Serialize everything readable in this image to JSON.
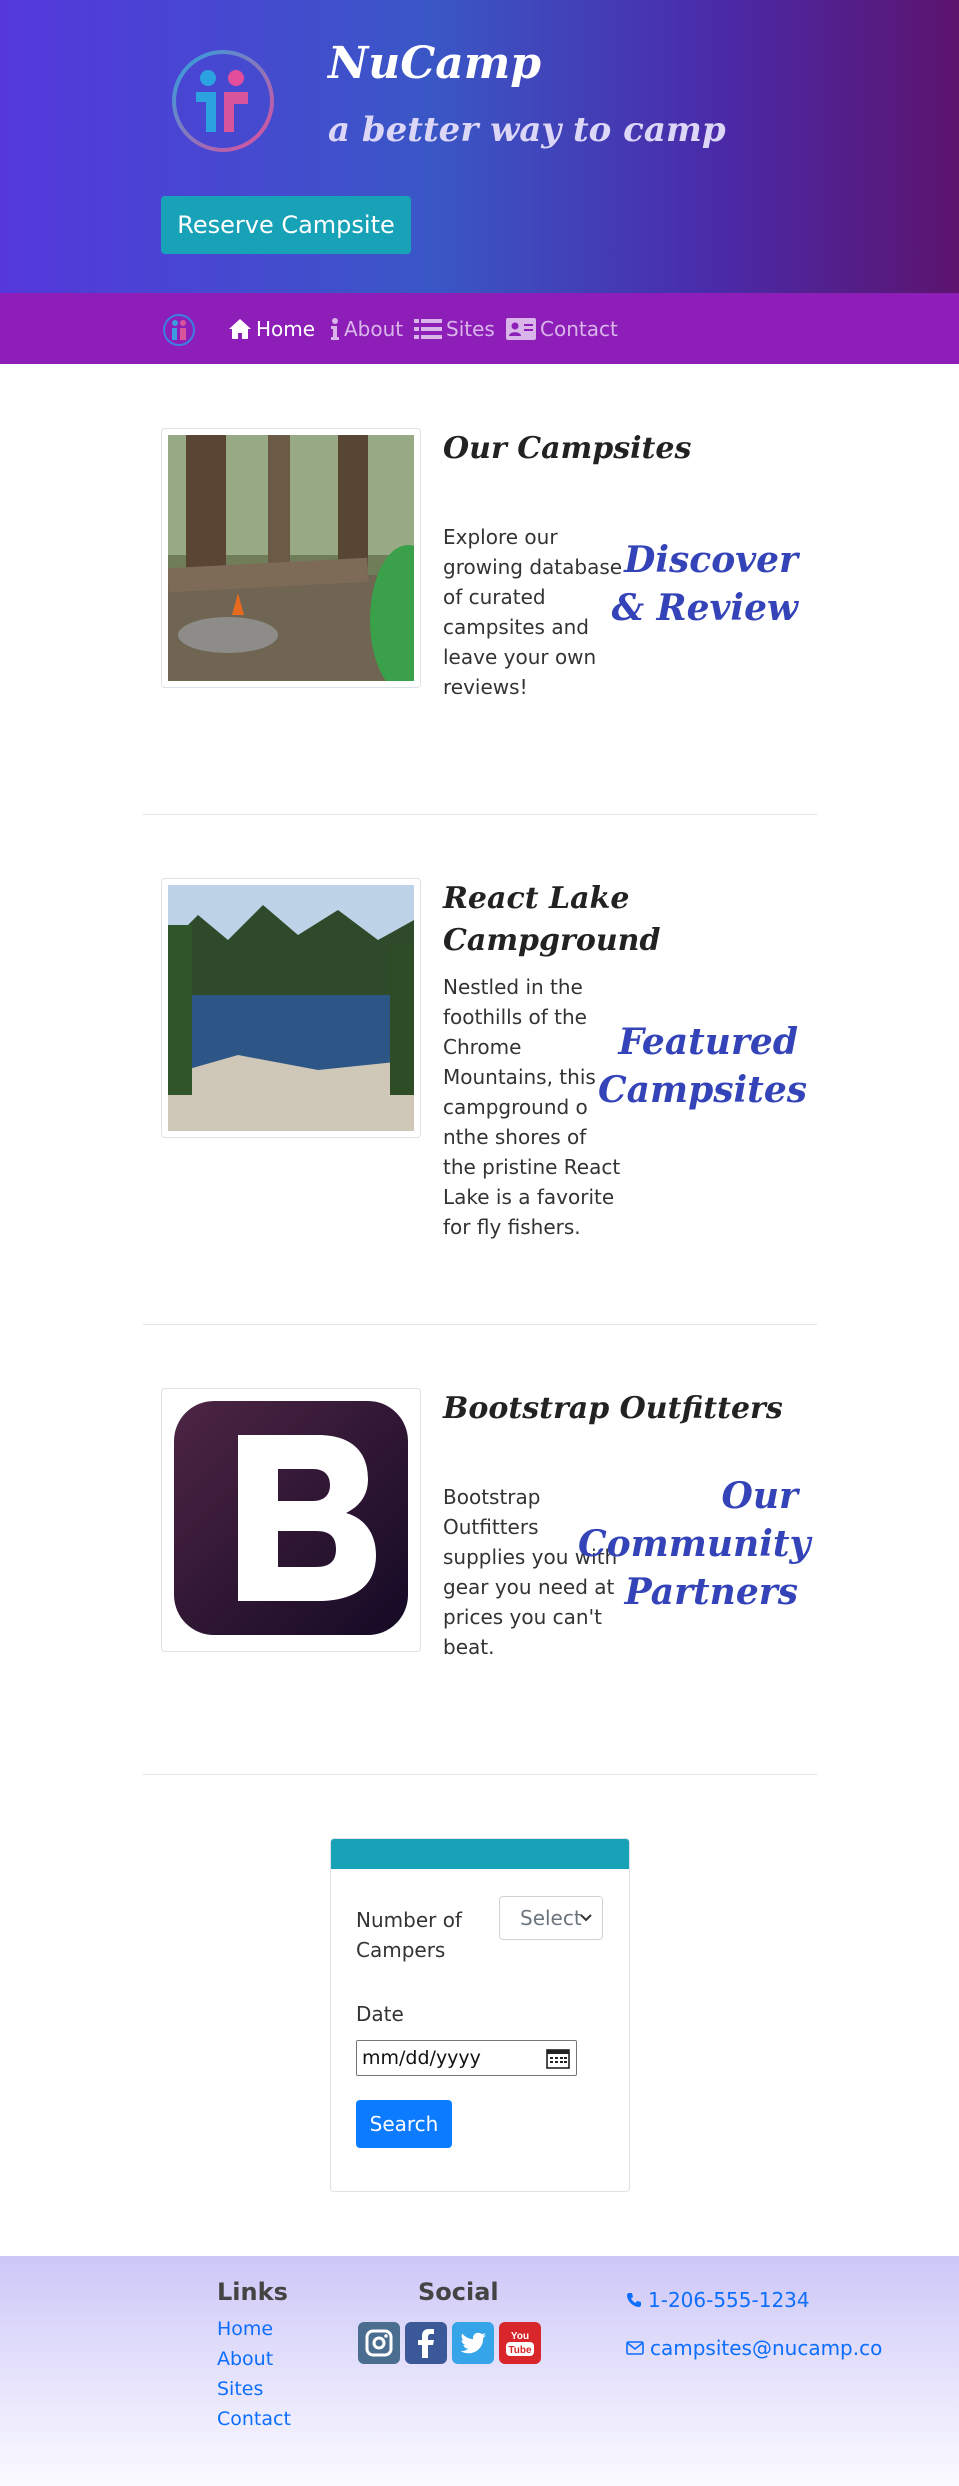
{
  "header": {
    "brand": "NuCamp",
    "tagline": "a better way to camp",
    "reserve_label": "Reserve Campsite"
  },
  "nav": {
    "items": [
      {
        "label": "Home",
        "icon": "home-icon"
      },
      {
        "label": "About",
        "icon": "info-icon"
      },
      {
        "label": "Sites",
        "icon": "list-icon"
      },
      {
        "label": "Contact",
        "icon": "address-card-icon"
      }
    ]
  },
  "sections": [
    {
      "title": "Our Campsites",
      "text": "Explore our growing database of curated campsites and leave your own reviews!",
      "tagline": "Discover & Review"
    },
    {
      "title": "React Lake Campground",
      "text": "Nestled in the foothills of the Chrome Mountains, this campground o nthe shores of the pristine React Lake is a favorite for fly fishers.",
      "tagline": "Featured Campsites"
    },
    {
      "title": "Bootstrap Outfitters",
      "text": "Bootstrap Outfitters supplies you with gear you need at prices you can't beat.",
      "tagline": "Our Community Partners"
    }
  ],
  "search_form": {
    "campers_label": "Number of Campers",
    "campers_selected": "Select",
    "date_label": "Date",
    "date_placeholder": "mm/dd/yyyy",
    "search_label": "Search"
  },
  "footer": {
    "links_heading": "Links",
    "links": [
      "Home",
      "About",
      "Sites",
      "Contact"
    ],
    "social_heading": "Social",
    "social": [
      "instagram-icon",
      "facebook-icon",
      "twitter-icon",
      "youtube-icon"
    ],
    "phone": "1-206-555-1234",
    "email": "campsites@nucamp.co"
  },
  "colors": {
    "accent": "#17a2b8",
    "nav": "#8d1fb8",
    "tagline": "#3444b8",
    "primary": "#0d7bff"
  }
}
